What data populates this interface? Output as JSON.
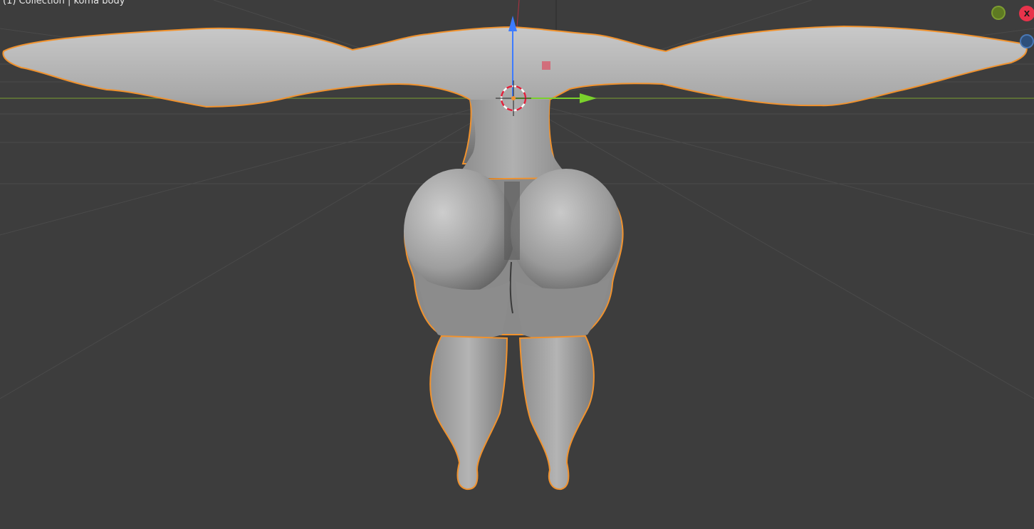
{
  "viewport": {
    "overlay_text": "(1) Collection | koma body",
    "background": "#3d3d3d",
    "grid_color": "#4a4a4a",
    "x_axis_color": "#7a9a3a",
    "outline_color": "#f0922e",
    "mesh_color": "#a8a8a8"
  },
  "gizmo": {
    "x_label": "X",
    "x_color": "#e8334b",
    "y_color": "#7c9c30",
    "z_color": "#4a78b5"
  },
  "transform_gizmo": {
    "z_arrow_color": "#3c7bff",
    "y_arrow_color": "#7ad12c"
  }
}
